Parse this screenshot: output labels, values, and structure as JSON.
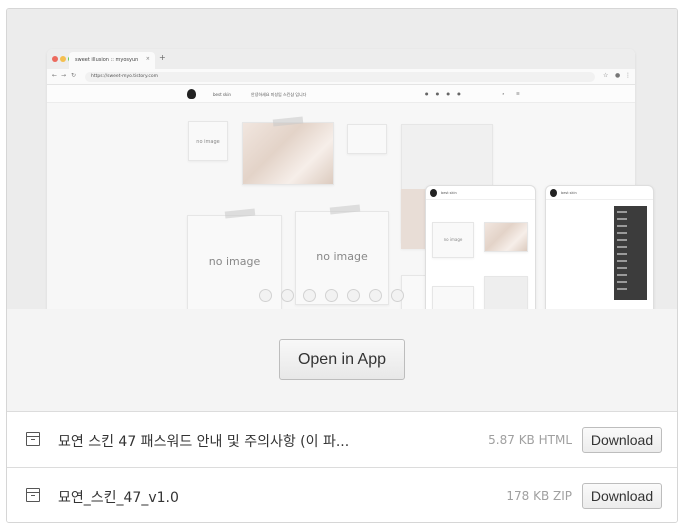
{
  "preview": {
    "tab_title": "sweet illusion :: myosyun",
    "tab_close": "×",
    "tab_new": "+",
    "url": "https://sweet-myo.tistory.com",
    "site_name": "best skin",
    "site_tagline": "안녕하세요 미성입 스킨샵 입니다",
    "placeholders": [
      "no image",
      "no image",
      "no image"
    ],
    "mobile_site_name": "best skin"
  },
  "open_in_app_label": "Open in App",
  "files": [
    {
      "name": "묘연 스킨 47 패스워드 안내 및 주의사항 (이 파...",
      "meta": "5.87 KB HTML",
      "download_label": "Download"
    },
    {
      "name": "묘연_스킨_47_v1.0",
      "meta": "178 KB ZIP",
      "download_label": "Download"
    }
  ],
  "colors": {
    "dot_red": "#ec6a5e",
    "dot_yellow": "#f4bf4f",
    "dot_green": "#61c554"
  }
}
